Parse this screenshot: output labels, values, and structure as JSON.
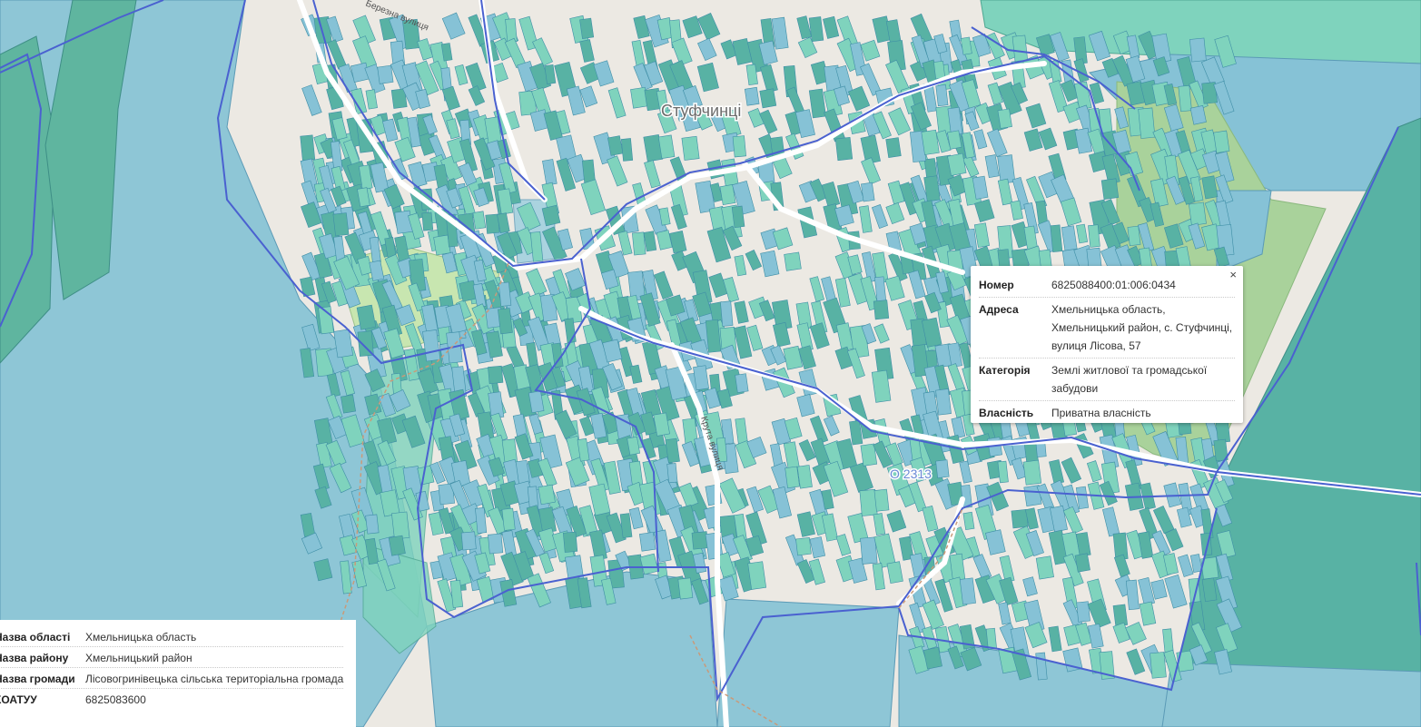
{
  "map": {
    "labels": {
      "village": "Стуфчинці",
      "street_bereznya": "Березна вулиця",
      "street_kruta": "Крута вулиця",
      "road_code": "О 2313"
    },
    "colors": {
      "background": "#ece9e3",
      "parcel_light": "#7fd3bd",
      "parcel_blue": "#86c2d6",
      "parcel_dark": "#58b2a4",
      "boundary": "#4a61d0",
      "forest": "#a9d29b",
      "water": "#aad3df"
    }
  },
  "popup": {
    "close_label": "×",
    "rows": [
      {
        "key": "Номер",
        "value": "6825088400:01:006:0434"
      },
      {
        "key": "Адреса",
        "value": "Хмельницька область, Хмельницький район, с. Стуфчинці, вулиця Лісова, 57"
      },
      {
        "key": "Категорія",
        "value": "Землі житлової та громадської забудови"
      },
      {
        "key": "Власність",
        "value": "Приватна власність"
      }
    ]
  },
  "info": {
    "rows": [
      {
        "key": "Назва області",
        "value": "Хмельницька область"
      },
      {
        "key": "Назва району",
        "value": "Хмельницький район"
      },
      {
        "key": "Назва громади",
        "value": "Лісовогринівецька сільська територіальна громада"
      },
      {
        "key": "КОАТУУ",
        "value": "6825083600"
      }
    ]
  }
}
